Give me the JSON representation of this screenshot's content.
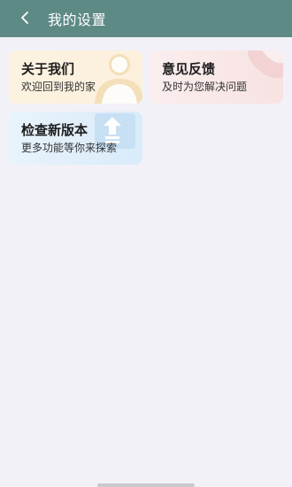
{
  "header": {
    "title": "我的设置",
    "back_icon": "chevron-left-icon"
  },
  "cards": [
    {
      "label": "关于我们",
      "sub": "欢迎回到我的家",
      "icon": "user-avatar-icon"
    },
    {
      "label": "意见反馈",
      "sub": "及时为您解决问题",
      "icon": "feedback-icon"
    },
    {
      "label": "检查新版本",
      "sub": "更多功能等你来探索",
      "icon": "upgrade-arrow-icon"
    }
  ],
  "colors": {
    "header_bg": "#5e8a86",
    "page_bg": "#f2f1f8",
    "about_bg": "#fbf2e0",
    "feedback_bg": "#f8e2e2",
    "update_bg": "#d9ebf9"
  }
}
